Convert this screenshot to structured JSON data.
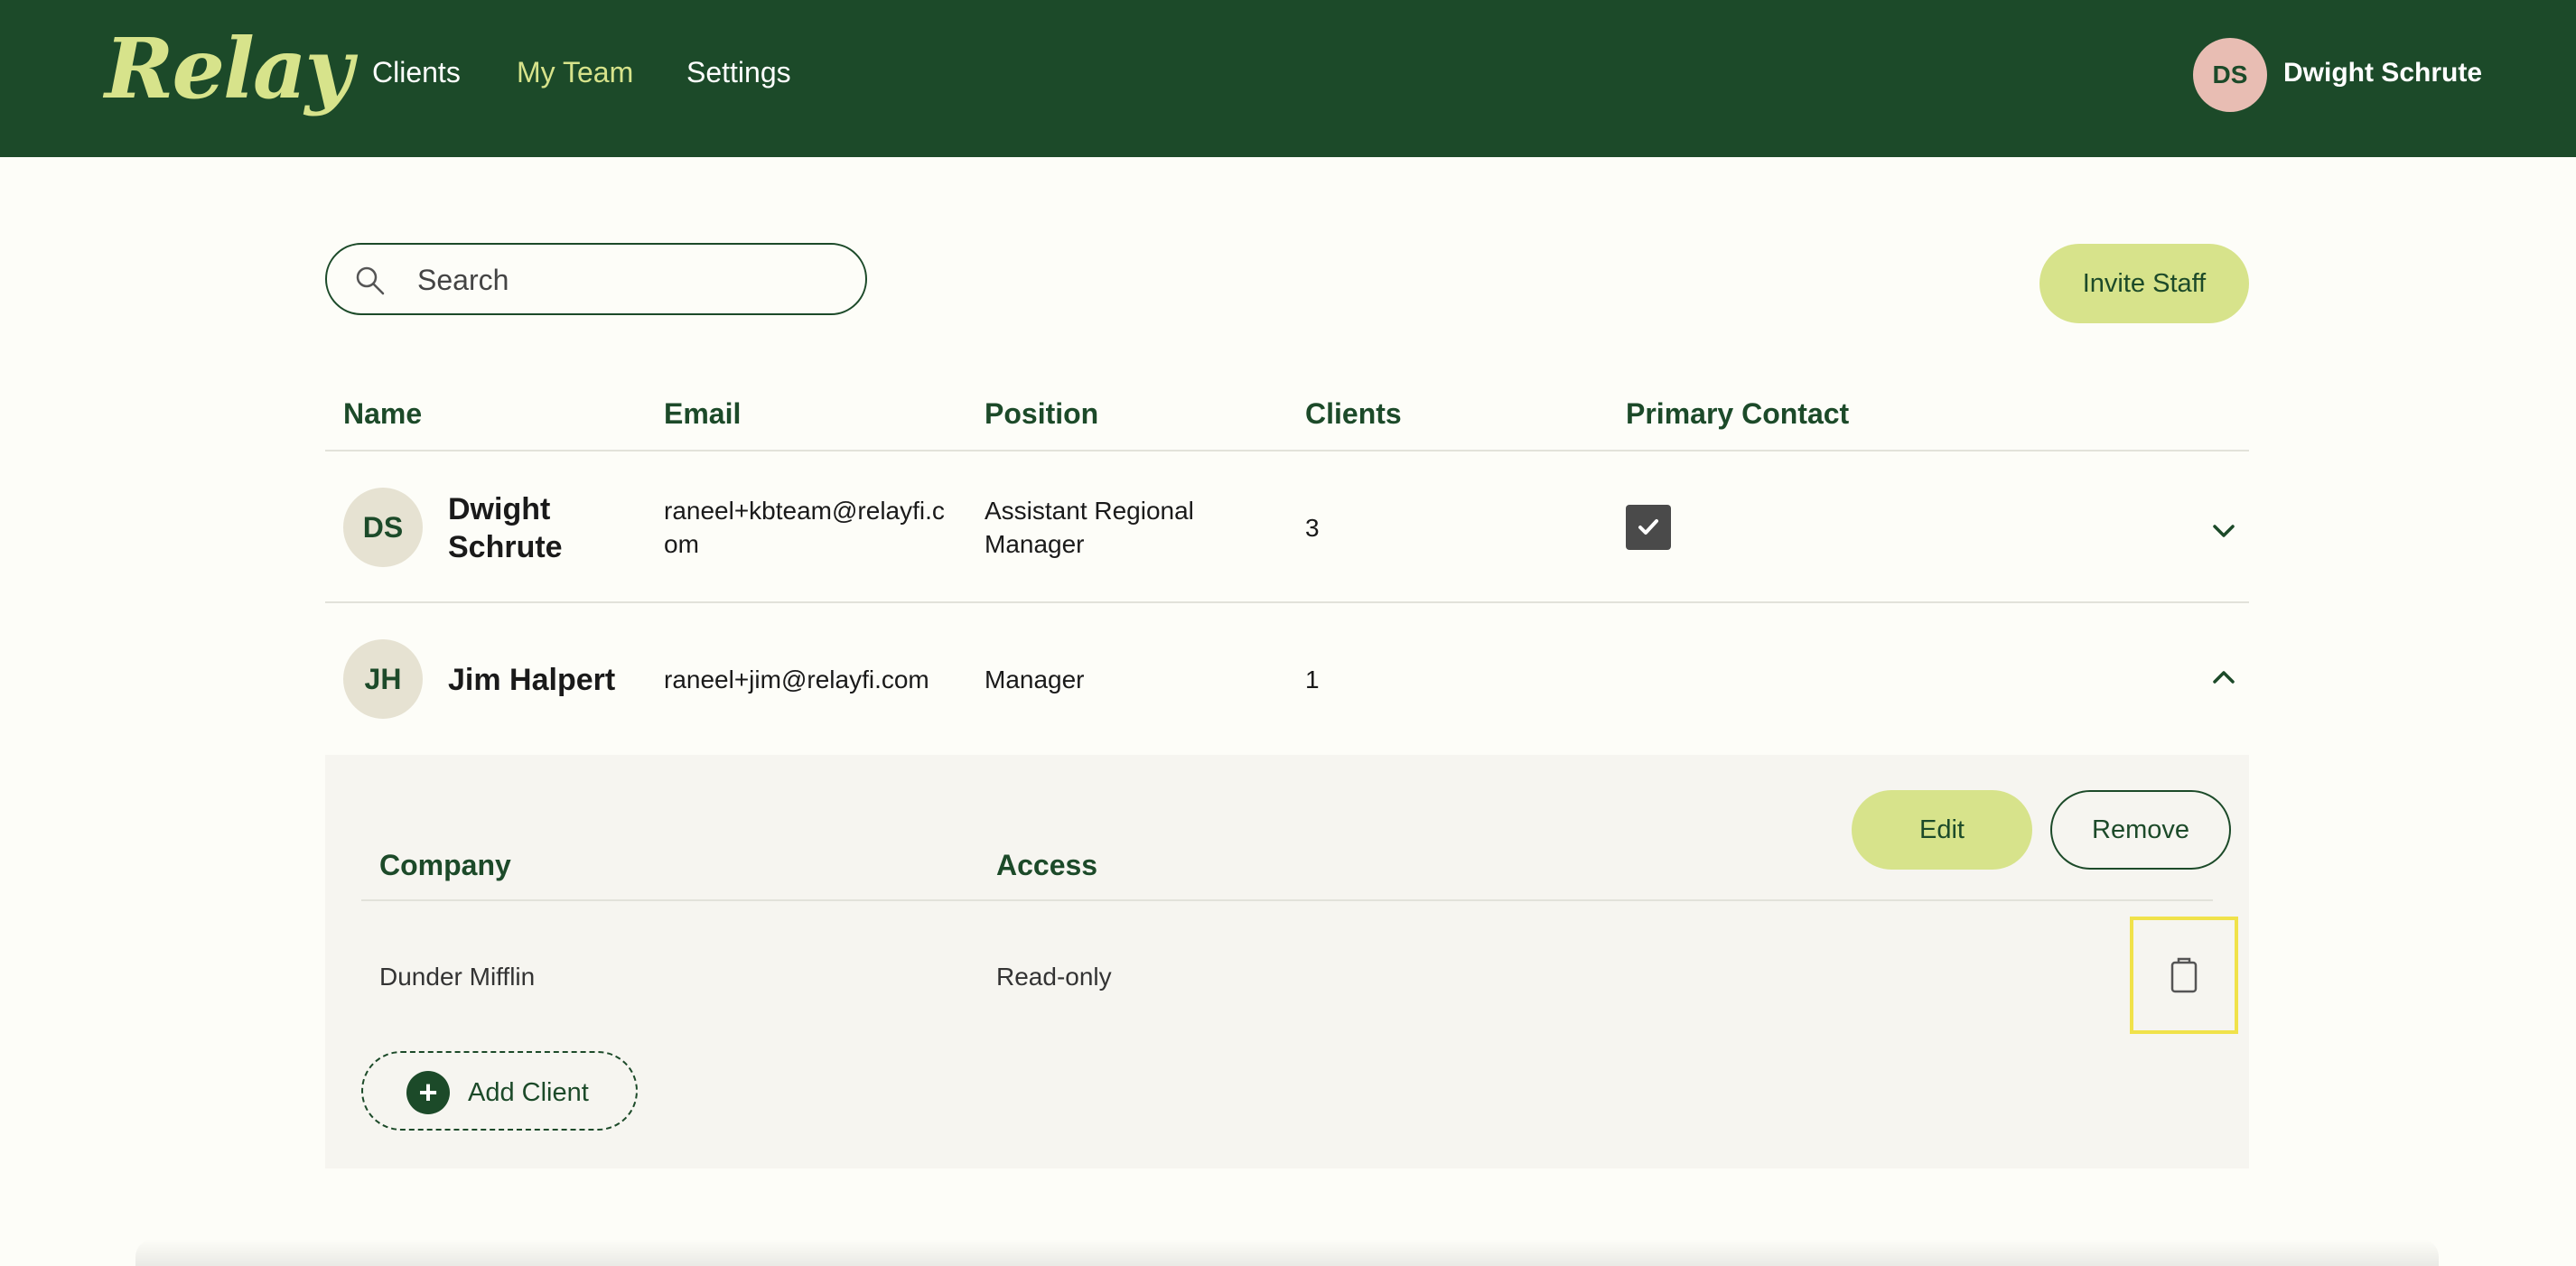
{
  "header": {
    "logo": "Relay",
    "nav": [
      {
        "label": "Clients",
        "active": false
      },
      {
        "label": "My Team",
        "active": true
      },
      {
        "label": "Settings",
        "active": false
      }
    ],
    "user": {
      "initials": "DS",
      "name": "Dwight Schrute"
    }
  },
  "toolbar": {
    "search_placeholder": "Search",
    "invite_label": "Invite Staff"
  },
  "table": {
    "headers": [
      "Name",
      "Email",
      "Position",
      "Clients",
      "Primary Contact"
    ],
    "rows": [
      {
        "initials": "DS",
        "name_line1": "Dwight",
        "name_line2": "Schrute",
        "email_line1": "raneel+kbteam@relayfi.c",
        "email_line2": "om",
        "position_line1": "Assistant Regional",
        "position_line2": "Manager",
        "clients": "3",
        "primary_contact": true,
        "expanded": false
      },
      {
        "initials": "JH",
        "name": "Jim Halpert",
        "email": "raneel+jim@relayfi.com",
        "position": "Manager",
        "clients": "1",
        "primary_contact": false,
        "expanded": true
      }
    ]
  },
  "detail": {
    "edit_label": "Edit",
    "remove_label": "Remove",
    "headers": [
      "Company",
      "Access"
    ],
    "rows": [
      {
        "company": "Dunder Mifflin",
        "access": "Read-only"
      }
    ],
    "add_client_label": "Add Client"
  },
  "colors": {
    "brand_dark": "#1c4a29",
    "brand_accent": "#d7e38b",
    "highlight": "#f0e24a"
  }
}
